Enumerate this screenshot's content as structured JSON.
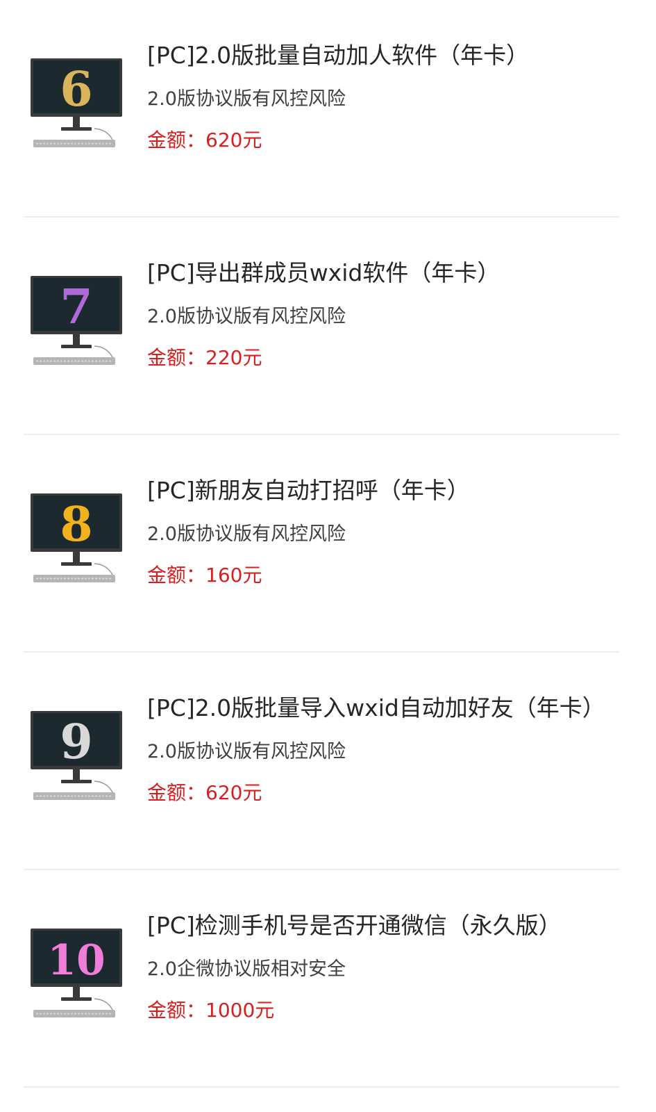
{
  "products": [
    {
      "title": "[PC]2.0版批量自动加人软件（年卡）",
      "subtitle": "2.0版协议版有风控风险",
      "price_label": "金额：",
      "price_value": "620元",
      "thumb_digit": "6",
      "thumb_color": "#d9b45a"
    },
    {
      "title": "[PC]导出群成员wxid软件（年卡）",
      "subtitle": "2.0版协议版有风控风险",
      "price_label": "金额：",
      "price_value": "220元",
      "thumb_digit": "7",
      "thumb_color": "#b06ad8"
    },
    {
      "title": "[PC]新朋友自动打招呼（年卡）",
      "subtitle": "2.0版协议版有风控风险",
      "price_label": "金额：",
      "price_value": "160元",
      "thumb_digit": "8",
      "thumb_color": "#f2b21c"
    },
    {
      "title": "[PC]2.0版批量导入wxid自动加好友（年卡）",
      "subtitle": "2.0版协议版有风控风险",
      "price_label": "金额：",
      "price_value": "620元",
      "thumb_digit": "9",
      "thumb_color": "#d8d8d8"
    },
    {
      "title": "[PC]检测手机号是否开通微信（永久版）",
      "subtitle": "2.0企微协议版相对安全",
      "price_label": "金额：",
      "price_value": "1000元",
      "thumb_digit": "10",
      "thumb_color": "#f07ed8"
    }
  ],
  "colors": {
    "price": "#d81e1e",
    "divider": "#ececec",
    "screen": "#1c2a30"
  }
}
